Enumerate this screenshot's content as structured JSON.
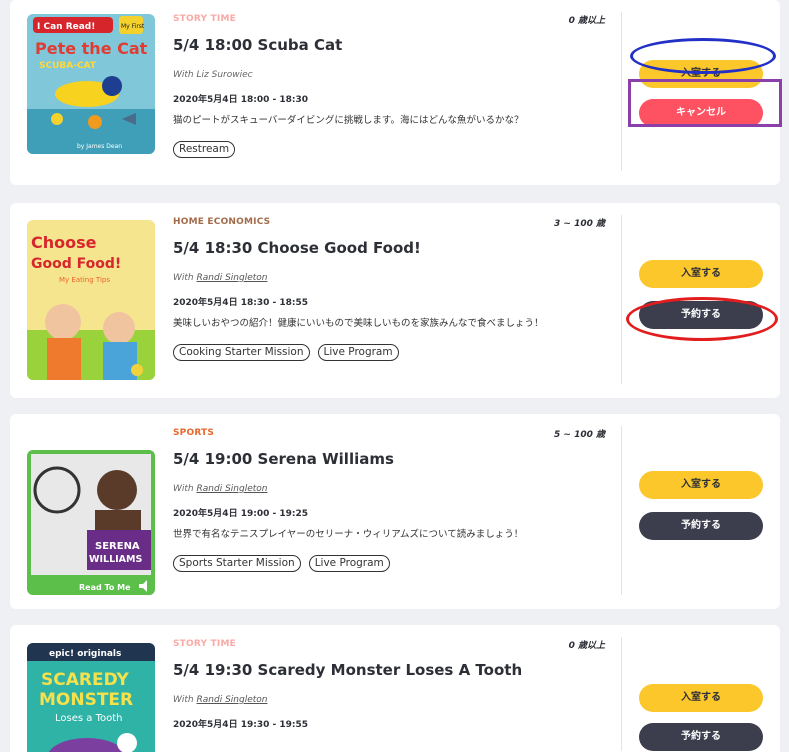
{
  "events": [
    {
      "category": "STORY TIME",
      "category_color": "#f9aaa5",
      "age": "0 歳以上",
      "title": "5/4 18:00 Scuba Cat",
      "with_prefix": "With",
      "host": "Liz Surowiec",
      "datetime": "2020年5月4日 18:00 - 18:30",
      "description": "猫のピートがスキューバーダイビングに挑戦します。海にはどんな魚がいるかな？",
      "tags": [
        "Restream"
      ],
      "buttons": {
        "enter": "入室する",
        "cancel": "キャンセル"
      },
      "cover": {
        "badge": "I Can Read!",
        "series": "My First",
        "title_top": "Pete the Cat",
        "title_sub": "SCUBA-CAT",
        "author": "by James Dean"
      }
    },
    {
      "category": "HOME ECONOMICS",
      "category_color": "#a36b4a",
      "age": "3 ~ 100 歳",
      "title": "5/4 18:30 Choose Good Food!",
      "with_prefix": "With",
      "host": "Randi Singleton",
      "datetime": "2020年5月4日 18:30 - 18:55",
      "description": "美味しいおやつの紹介！健康にいいもので美味しいものを家族みんなで食べましょう！",
      "tags": [
        "Cooking Starter Mission",
        "Live Program"
      ],
      "buttons": {
        "enter": "入室する",
        "reserve": "予約する"
      },
      "cover": {
        "title_top": "Choose",
        "title_sub": "Good Food!",
        "subtitle": "My Eating Tips"
      }
    },
    {
      "category": "SPORTS",
      "category_color": "#e8672c",
      "age": "5 ~ 100 歳",
      "title": "5/4 19:00 Serena Williams",
      "with_prefix": "With",
      "host": "Randi Singleton",
      "datetime": "2020年5月4日 19:00 - 19:25",
      "description": "世界で有名なテニスプレイヤーのセリーナ・ウィリアムズについて読みましょう！",
      "tags": [
        "Sports Starter Mission",
        "Live Program"
      ],
      "buttons": {
        "enter": "入室する",
        "reserve": "予約する"
      },
      "cover": {
        "title_top": "SERENA",
        "title_sub": "WILLIAMS",
        "footer": "Read To Me"
      }
    },
    {
      "category": "STORY TIME",
      "category_color": "#f9aaa5",
      "age": "0 歳以上",
      "title": "5/4 19:30 Scaredy Monster Loses A Tooth",
      "with_prefix": "With",
      "host": "Randi Singleton",
      "datetime": "2020年5月4日 19:30 - 19:55",
      "description": "",
      "tags": [],
      "buttons": {
        "enter": "入室する",
        "reserve": "予約する"
      },
      "cover": {
        "badge": "epic! originals",
        "title_top": "SCAREDY",
        "title_mid": "MONSTER",
        "title_sub": "Loses a Tooth"
      }
    }
  ]
}
